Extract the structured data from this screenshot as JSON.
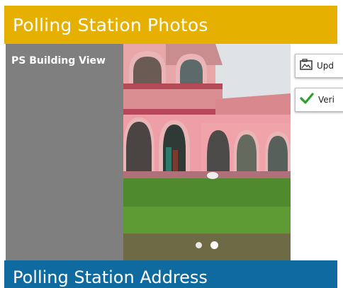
{
  "header": {
    "title": "Polling Station Photos"
  },
  "photo_section": {
    "view_label": "PS Building View",
    "actions": {
      "update_label": "Upd",
      "verify_label": "Veri"
    },
    "pager": {
      "total": 2,
      "active_index": 1
    }
  },
  "address_section": {
    "title": "Polling Station Address"
  },
  "colors": {
    "header_bg": "#e6b000",
    "panel_bg": "#7f7f7f",
    "address_bg": "#0f6b9f",
    "verify_check": "#2e9e2e"
  },
  "icons": {
    "update": "image-upload-icon",
    "verify": "checkmark-icon"
  }
}
